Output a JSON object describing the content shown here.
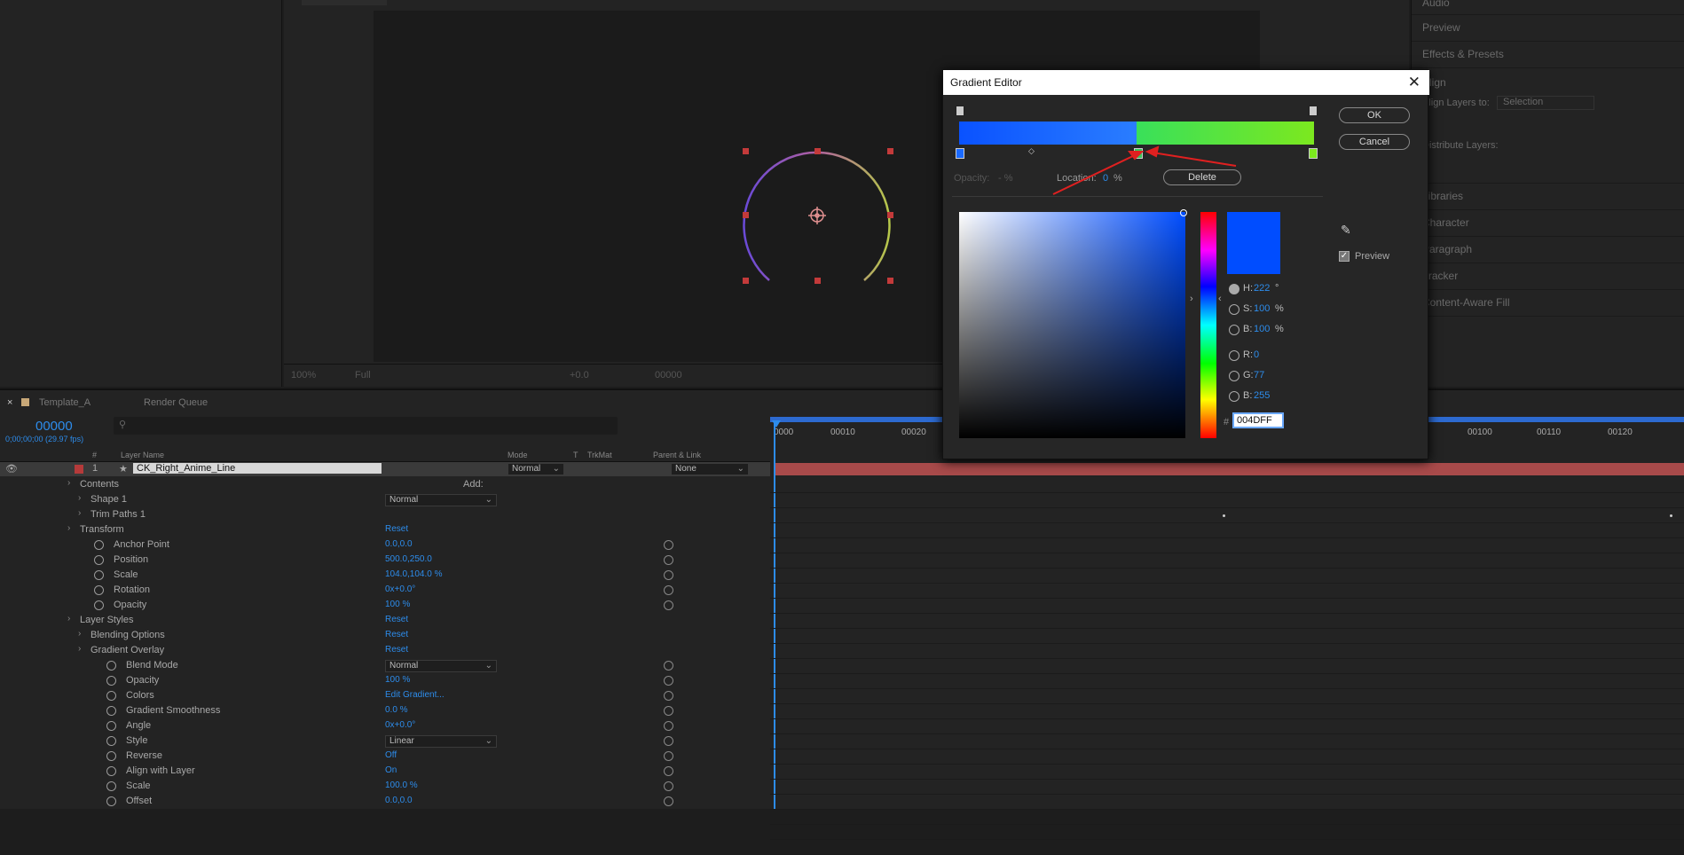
{
  "project_panel": {},
  "comp_toolbar": {
    "zoom": "100%",
    "resolution": "Full",
    "exposure": "+0.0",
    "timecode": "00000"
  },
  "right_panel": {
    "items": [
      "Audio",
      "Preview",
      "Effects & Presets"
    ],
    "align": {
      "title": "Align",
      "align_to_label": "Align Layers to:",
      "align_to_value": "Selection",
      "distribute_label": "Distribute Layers:"
    },
    "items2": [
      "Libraries",
      "Character",
      "Paragraph",
      "Tracker",
      "Content-Aware Fill"
    ]
  },
  "timeline": {
    "tab_comp": "Template_A",
    "tab_render": "Render Queue",
    "timecode": "00000",
    "timecode_sub": "0;00;00;00 (29.97 fps)",
    "headers": {
      "num": "#",
      "layer_name": "Layer Name",
      "mode": "Mode",
      "t": "T",
      "trkmat": "TrkMat",
      "parent": "Parent & Link"
    },
    "layer": {
      "index": "1",
      "name": "CK_Right_Anime_Line",
      "mode": "Normal",
      "parent": "None"
    },
    "rows": [
      {
        "label": "Contents",
        "extra": "Add:"
      },
      {
        "label": "Shape 1",
        "dropdown": "Normal"
      },
      {
        "label": "Trim Paths 1"
      },
      {
        "label": "Transform",
        "value": "Reset"
      },
      {
        "label": "Anchor Point",
        "value": "0.0,0.0"
      },
      {
        "label": "Position",
        "value": "500.0,250.0"
      },
      {
        "label": "Scale",
        "value": "104.0,104.0 %"
      },
      {
        "label": "Rotation",
        "value": "0x+0.0°"
      },
      {
        "label": "Opacity",
        "value": "100 %"
      },
      {
        "label": "Layer Styles",
        "value": "Reset"
      },
      {
        "label": "Blending Options",
        "value": "Reset"
      },
      {
        "label": "Gradient Overlay",
        "value": "Reset"
      },
      {
        "label": "Blend Mode",
        "dropdown": "Normal"
      },
      {
        "label": "Opacity",
        "value": "100 %"
      },
      {
        "label": "Colors",
        "value": "Edit Gradient..."
      },
      {
        "label": "Gradient Smoothness",
        "value": "0.0 %"
      },
      {
        "label": "Angle",
        "value": "0x+0.0°"
      },
      {
        "label": "Style",
        "dropdown": "Linear"
      },
      {
        "label": "Reverse",
        "value": "Off"
      },
      {
        "label": "Align with Layer",
        "value": "On"
      },
      {
        "label": "Scale",
        "value": "100.0 %"
      },
      {
        "label": "Offset",
        "value": "0.0,0.0"
      }
    ],
    "ruler": [
      "0000",
      "00010",
      "00020",
      "00100",
      "00110",
      "00120"
    ]
  },
  "gradient_editor": {
    "title": "Gradient Editor",
    "ok": "OK",
    "cancel": "Cancel",
    "opacity_label": "Opacity:",
    "opacity_value": "- %",
    "location_label": "Location:",
    "location_value": "0",
    "location_unit": "%",
    "delete": "Delete",
    "preview_label": "Preview",
    "h_label": "H:",
    "h_value": "222",
    "h_unit": "°",
    "s_label": "S:",
    "s_value": "100",
    "s_unit": "%",
    "b_label": "B:",
    "b_value": "100",
    "b_unit": "%",
    "r_label": "R:",
    "r_value": "0",
    "g_label": "G:",
    "g_value": "77",
    "bb_label": "B:",
    "bb_value": "255",
    "hex_label": "#",
    "hex_value": "004DFF",
    "current_color": "#004dff"
  }
}
